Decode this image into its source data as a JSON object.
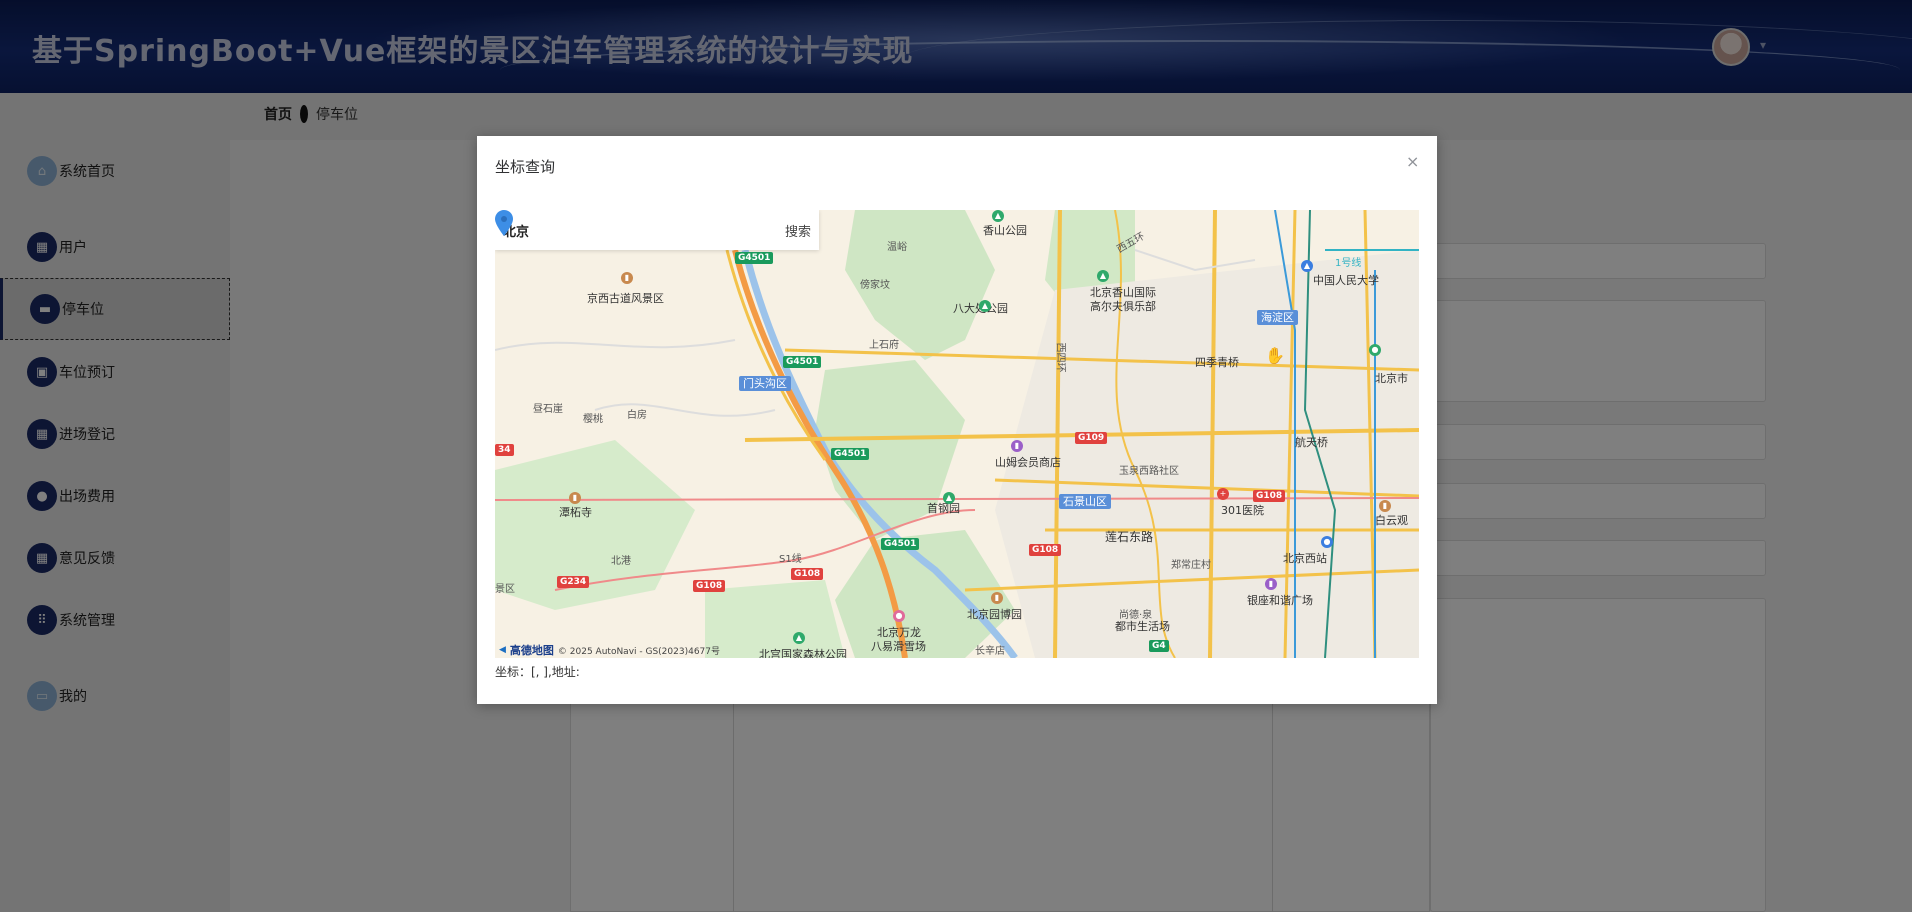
{
  "header": {
    "title": "基于SpringBoot+Vue框架的景区泊车管理系统的设计与实现",
    "avatar_caret": "▾"
  },
  "breadcrumb": {
    "home": "首页",
    "current": "停车位"
  },
  "sidebar": {
    "items": [
      {
        "label": "系统首页",
        "icon": "home-icon"
      },
      {
        "label": "用户",
        "icon": "grid-icon"
      },
      {
        "label": "停车位",
        "icon": "chat-icon",
        "active": true
      },
      {
        "label": "车位预订",
        "icon": "briefcase-icon"
      },
      {
        "label": "进场登记",
        "icon": "grid-icon"
      },
      {
        "label": "出场费用",
        "icon": "person-icon"
      },
      {
        "label": "意见反馈",
        "icon": "grid-icon"
      },
      {
        "label": "系统管理",
        "icon": "apps-icon"
      },
      {
        "label": "我的",
        "icon": "card-icon"
      }
    ]
  },
  "dialog": {
    "title": "坐标查询",
    "close": "×",
    "search_value": "北京",
    "search_button": "搜索",
    "coord_text": "坐标：[, ],地址:"
  },
  "map": {
    "attribution_logo": "高德地图",
    "attribution_text": "© 2025 AutoNavi - GS(2023)4677号",
    "labels": [
      {
        "text": "香山公园"
      },
      {
        "text": "温峪"
      },
      {
        "text": "傍家坟"
      },
      {
        "text": "京西古道风景区"
      },
      {
        "text": "八大处公园"
      },
      {
        "text": "北京香山国际"
      },
      {
        "text": "高尔夫俱乐部"
      },
      {
        "text": "中国人民大学"
      },
      {
        "text": "上石府"
      },
      {
        "text": "四季青桥"
      },
      {
        "text": "北京市"
      },
      {
        "text": "昼石崖"
      },
      {
        "text": "樱桃"
      },
      {
        "text": "白房"
      },
      {
        "text": "山姆会员商店"
      },
      {
        "text": "航天桥"
      },
      {
        "text": "玉泉西路社区"
      },
      {
        "text": "首钢园"
      },
      {
        "text": "301医院"
      },
      {
        "text": "白云观"
      },
      {
        "text": "潭柘寺"
      },
      {
        "text": "北港"
      },
      {
        "text": "莲石东路"
      },
      {
        "text": "北京西站"
      },
      {
        "text": "郑常庄村"
      },
      {
        "text": "银座和谐广场"
      },
      {
        "text": "尚德·泉"
      },
      {
        "text": "都市生活场"
      },
      {
        "text": "北京园博园"
      },
      {
        "text": "北京万龙"
      },
      {
        "text": "八易滑雪场"
      },
      {
        "text": "北宫国家森林公园"
      },
      {
        "text": "长辛店"
      },
      {
        "text": "景区"
      },
      {
        "text": "西四环"
      },
      {
        "text": "西五环"
      },
      {
        "text": "1号线"
      },
      {
        "text": "S1线"
      }
    ],
    "districts": [
      {
        "text": "海淀区"
      },
      {
        "text": "门头沟区"
      },
      {
        "text": "石景山区"
      }
    ],
    "shields": [
      {
        "text": "G4501"
      },
      {
        "text": "G4501"
      },
      {
        "text": "G4501"
      },
      {
        "text": "G4501"
      },
      {
        "text": "G109"
      },
      {
        "text": "G108"
      },
      {
        "text": "G108"
      },
      {
        "text": "G108"
      },
      {
        "text": "G108"
      },
      {
        "text": "G234"
      },
      {
        "text": "G4"
      },
      {
        "text": "34"
      }
    ]
  }
}
